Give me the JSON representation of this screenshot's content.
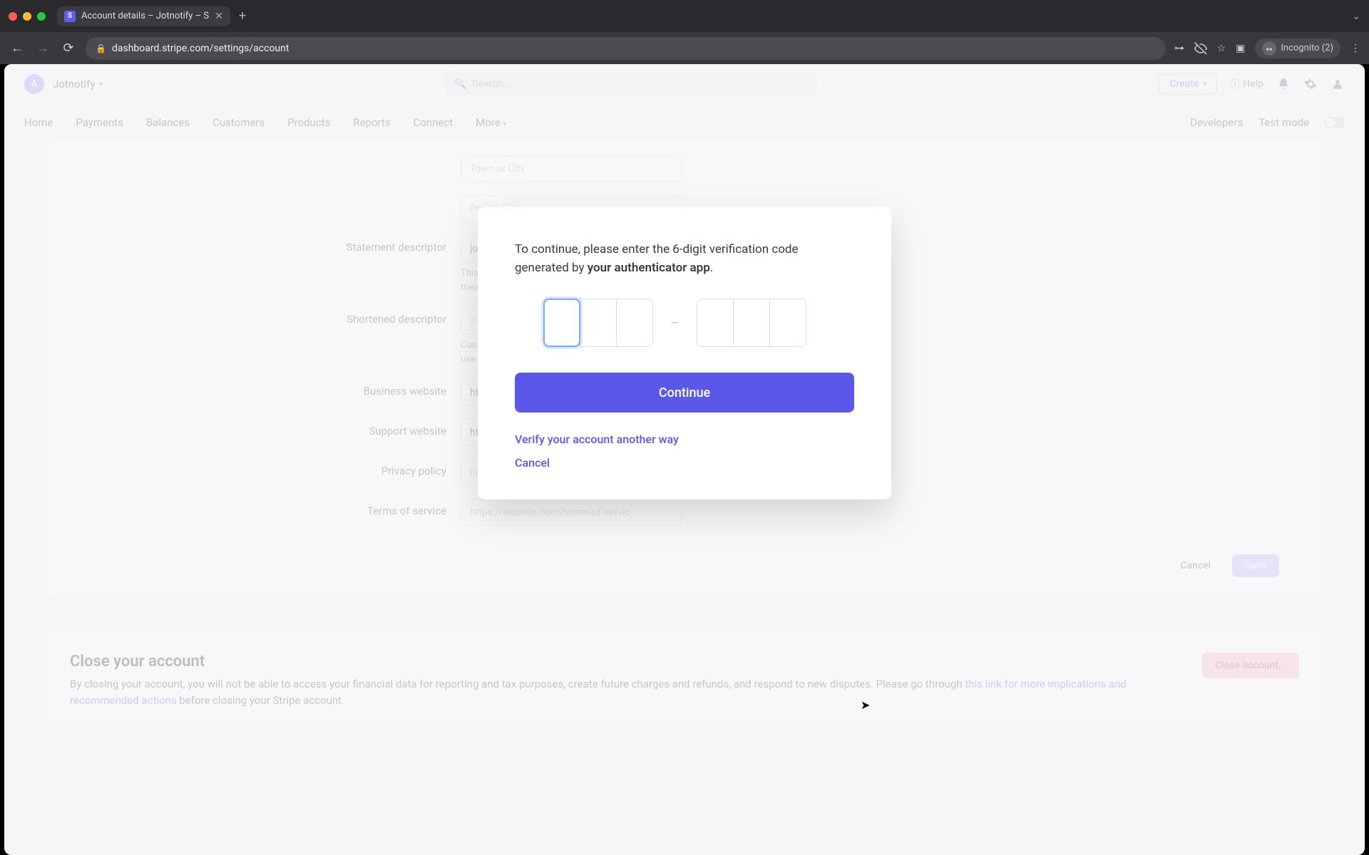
{
  "browser": {
    "tab_title": "Account details – Jotnotify – S",
    "url": "dashboard.stripe.com/settings/account",
    "incognito_label": "Incognito (2)"
  },
  "header": {
    "account_initial": "A",
    "account_name": "Jotnotify",
    "search_placeholder": "Search…",
    "create_label": "Create",
    "help_label": "Help"
  },
  "nav": {
    "items": [
      "Home",
      "Payments",
      "Balances",
      "Customers",
      "Products",
      "Reports",
      "Connect",
      "More"
    ],
    "developers": "Developers",
    "test_mode": "Test mode"
  },
  "form": {
    "town_placeholder": "Town or City",
    "postal_placeholder": "Postal code",
    "statement_label": "Statement descriptor",
    "statement_value": "jotn",
    "statement_help": "This is the business name your customers will see on their card statements and other transactions.",
    "shortened_label": "Shortened descriptor",
    "shortened_placeholder": "2–1",
    "shortened_help": "Customers will see this shortened descriptor if you use dynamic statement descriptors.",
    "website_label": "Business website",
    "website_value": "http",
    "support_label": "Support website",
    "support_value": "http",
    "privacy_label": "Privacy policy",
    "privacy_placeholder": "https://website.com/privacy-policy",
    "terms_label": "Terms of service",
    "terms_placeholder": "https://website.com/terms-of-servic",
    "cancel": "Cancel",
    "save": "Save"
  },
  "close_account": {
    "title": "Close your account",
    "desc_prefix": "By closing your account, you will not be able to access your financial data for reporting and tax purposes, create future charges and refunds, and respond to new disputes. Please go through ",
    "link_text": "this link for more implications and recommended actions",
    "desc_suffix": " before closing your Stripe account.",
    "button": "Close account..."
  },
  "modal": {
    "text_prefix": "To continue, please enter the 6-digit verification code generated by ",
    "text_bold": "your authenticator app",
    "text_suffix": ".",
    "continue": "Continue",
    "alt_verify": "Verify your account another way",
    "cancel": "Cancel",
    "sep": "–"
  }
}
